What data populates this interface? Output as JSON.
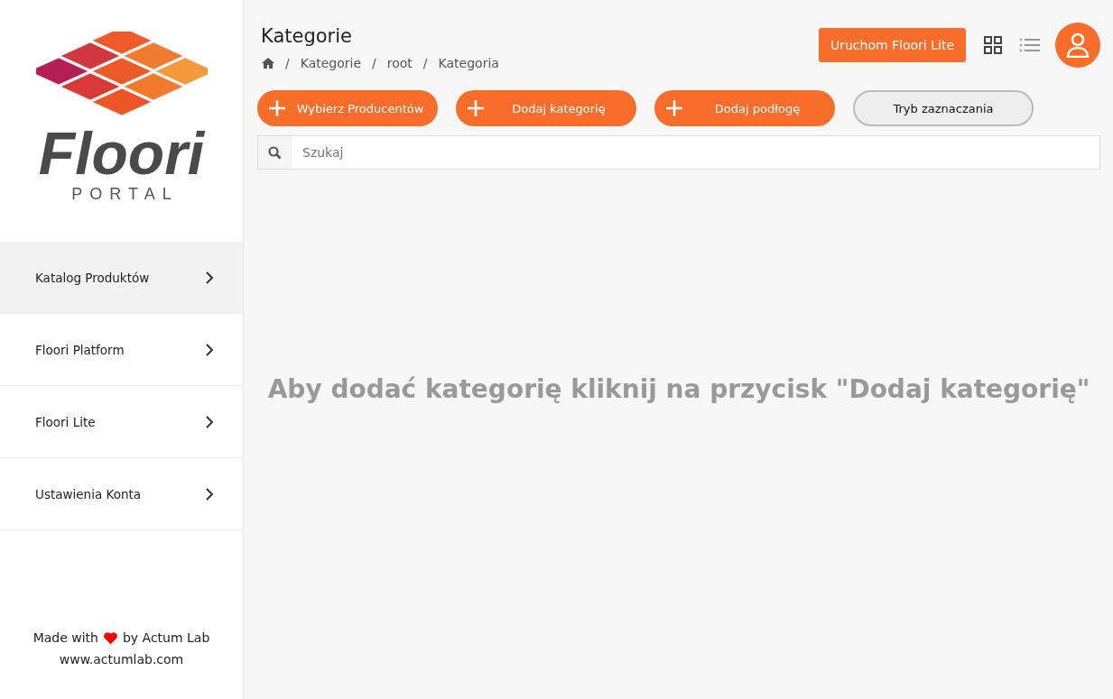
{
  "logo": {
    "name": "Floori",
    "subtitle": "PORTAL"
  },
  "sidebar": {
    "items": [
      {
        "label": "Katalog Produktów",
        "selected": true
      },
      {
        "label": "Floori Platform",
        "selected": false
      },
      {
        "label": "Floori Lite",
        "selected": false
      },
      {
        "label": "Ustawienia Konta",
        "selected": false
      }
    ],
    "footer": {
      "before": "Made with",
      "after": "by Actum Lab",
      "link": "www.actumlab.com"
    }
  },
  "header": {
    "title": "Kategorie",
    "breadcrumbs": [
      "Kategorie",
      "root",
      "Kategoria"
    ],
    "separator": "/",
    "launch_button": "Uruchom Floori Lite"
  },
  "actions": [
    {
      "label": "Wybierz Producentów",
      "kind": "primary"
    },
    {
      "label": "Dodaj kategorię",
      "kind": "primary"
    },
    {
      "label": "Dodaj podłogę",
      "kind": "primary"
    },
    {
      "label": "Tryb zaznaczania",
      "kind": "outline"
    }
  ],
  "search": {
    "placeholder": "Szukaj"
  },
  "empty_message": "Aby dodać kategorię kliknij na przycisk \"Dodaj kategorię\""
}
